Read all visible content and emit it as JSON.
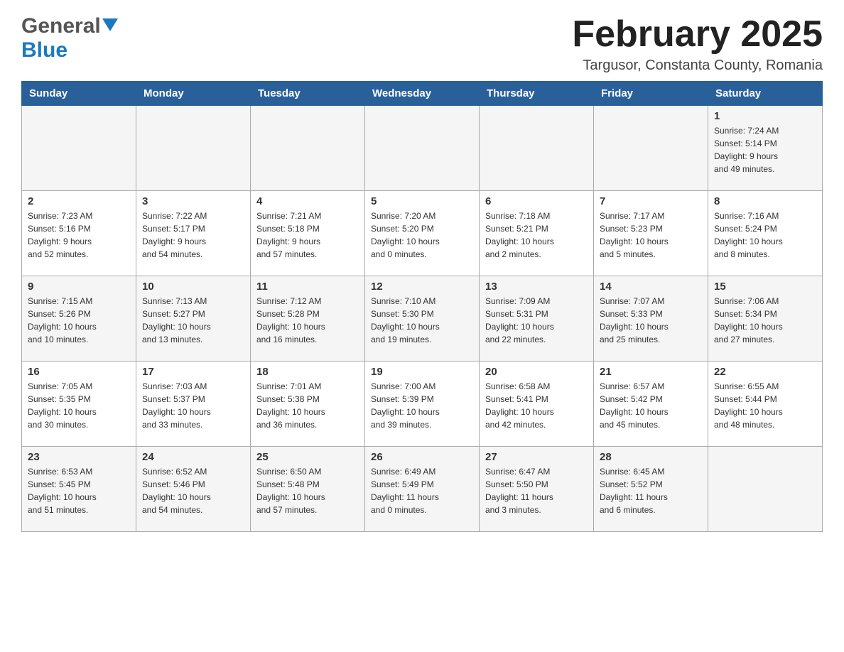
{
  "header": {
    "logo_general": "General",
    "logo_blue": "Blue",
    "month_year": "February 2025",
    "location": "Targusor, Constanta County, Romania"
  },
  "weekdays": [
    "Sunday",
    "Monday",
    "Tuesday",
    "Wednesday",
    "Thursday",
    "Friday",
    "Saturday"
  ],
  "weeks": [
    [
      {
        "day": "",
        "info": ""
      },
      {
        "day": "",
        "info": ""
      },
      {
        "day": "",
        "info": ""
      },
      {
        "day": "",
        "info": ""
      },
      {
        "day": "",
        "info": ""
      },
      {
        "day": "",
        "info": ""
      },
      {
        "day": "1",
        "info": "Sunrise: 7:24 AM\nSunset: 5:14 PM\nDaylight: 9 hours\nand 49 minutes."
      }
    ],
    [
      {
        "day": "2",
        "info": "Sunrise: 7:23 AM\nSunset: 5:16 PM\nDaylight: 9 hours\nand 52 minutes."
      },
      {
        "day": "3",
        "info": "Sunrise: 7:22 AM\nSunset: 5:17 PM\nDaylight: 9 hours\nand 54 minutes."
      },
      {
        "day": "4",
        "info": "Sunrise: 7:21 AM\nSunset: 5:18 PM\nDaylight: 9 hours\nand 57 minutes."
      },
      {
        "day": "5",
        "info": "Sunrise: 7:20 AM\nSunset: 5:20 PM\nDaylight: 10 hours\nand 0 minutes."
      },
      {
        "day": "6",
        "info": "Sunrise: 7:18 AM\nSunset: 5:21 PM\nDaylight: 10 hours\nand 2 minutes."
      },
      {
        "day": "7",
        "info": "Sunrise: 7:17 AM\nSunset: 5:23 PM\nDaylight: 10 hours\nand 5 minutes."
      },
      {
        "day": "8",
        "info": "Sunrise: 7:16 AM\nSunset: 5:24 PM\nDaylight: 10 hours\nand 8 minutes."
      }
    ],
    [
      {
        "day": "9",
        "info": "Sunrise: 7:15 AM\nSunset: 5:26 PM\nDaylight: 10 hours\nand 10 minutes."
      },
      {
        "day": "10",
        "info": "Sunrise: 7:13 AM\nSunset: 5:27 PM\nDaylight: 10 hours\nand 13 minutes."
      },
      {
        "day": "11",
        "info": "Sunrise: 7:12 AM\nSunset: 5:28 PM\nDaylight: 10 hours\nand 16 minutes."
      },
      {
        "day": "12",
        "info": "Sunrise: 7:10 AM\nSunset: 5:30 PM\nDaylight: 10 hours\nand 19 minutes."
      },
      {
        "day": "13",
        "info": "Sunrise: 7:09 AM\nSunset: 5:31 PM\nDaylight: 10 hours\nand 22 minutes."
      },
      {
        "day": "14",
        "info": "Sunrise: 7:07 AM\nSunset: 5:33 PM\nDaylight: 10 hours\nand 25 minutes."
      },
      {
        "day": "15",
        "info": "Sunrise: 7:06 AM\nSunset: 5:34 PM\nDaylight: 10 hours\nand 27 minutes."
      }
    ],
    [
      {
        "day": "16",
        "info": "Sunrise: 7:05 AM\nSunset: 5:35 PM\nDaylight: 10 hours\nand 30 minutes."
      },
      {
        "day": "17",
        "info": "Sunrise: 7:03 AM\nSunset: 5:37 PM\nDaylight: 10 hours\nand 33 minutes."
      },
      {
        "day": "18",
        "info": "Sunrise: 7:01 AM\nSunset: 5:38 PM\nDaylight: 10 hours\nand 36 minutes."
      },
      {
        "day": "19",
        "info": "Sunrise: 7:00 AM\nSunset: 5:39 PM\nDaylight: 10 hours\nand 39 minutes."
      },
      {
        "day": "20",
        "info": "Sunrise: 6:58 AM\nSunset: 5:41 PM\nDaylight: 10 hours\nand 42 minutes."
      },
      {
        "day": "21",
        "info": "Sunrise: 6:57 AM\nSunset: 5:42 PM\nDaylight: 10 hours\nand 45 minutes."
      },
      {
        "day": "22",
        "info": "Sunrise: 6:55 AM\nSunset: 5:44 PM\nDaylight: 10 hours\nand 48 minutes."
      }
    ],
    [
      {
        "day": "23",
        "info": "Sunrise: 6:53 AM\nSunset: 5:45 PM\nDaylight: 10 hours\nand 51 minutes."
      },
      {
        "day": "24",
        "info": "Sunrise: 6:52 AM\nSunset: 5:46 PM\nDaylight: 10 hours\nand 54 minutes."
      },
      {
        "day": "25",
        "info": "Sunrise: 6:50 AM\nSunset: 5:48 PM\nDaylight: 10 hours\nand 57 minutes."
      },
      {
        "day": "26",
        "info": "Sunrise: 6:49 AM\nSunset: 5:49 PM\nDaylight: 11 hours\nand 0 minutes."
      },
      {
        "day": "27",
        "info": "Sunrise: 6:47 AM\nSunset: 5:50 PM\nDaylight: 11 hours\nand 3 minutes."
      },
      {
        "day": "28",
        "info": "Sunrise: 6:45 AM\nSunset: 5:52 PM\nDaylight: 11 hours\nand 6 minutes."
      },
      {
        "day": "",
        "info": ""
      }
    ]
  ]
}
